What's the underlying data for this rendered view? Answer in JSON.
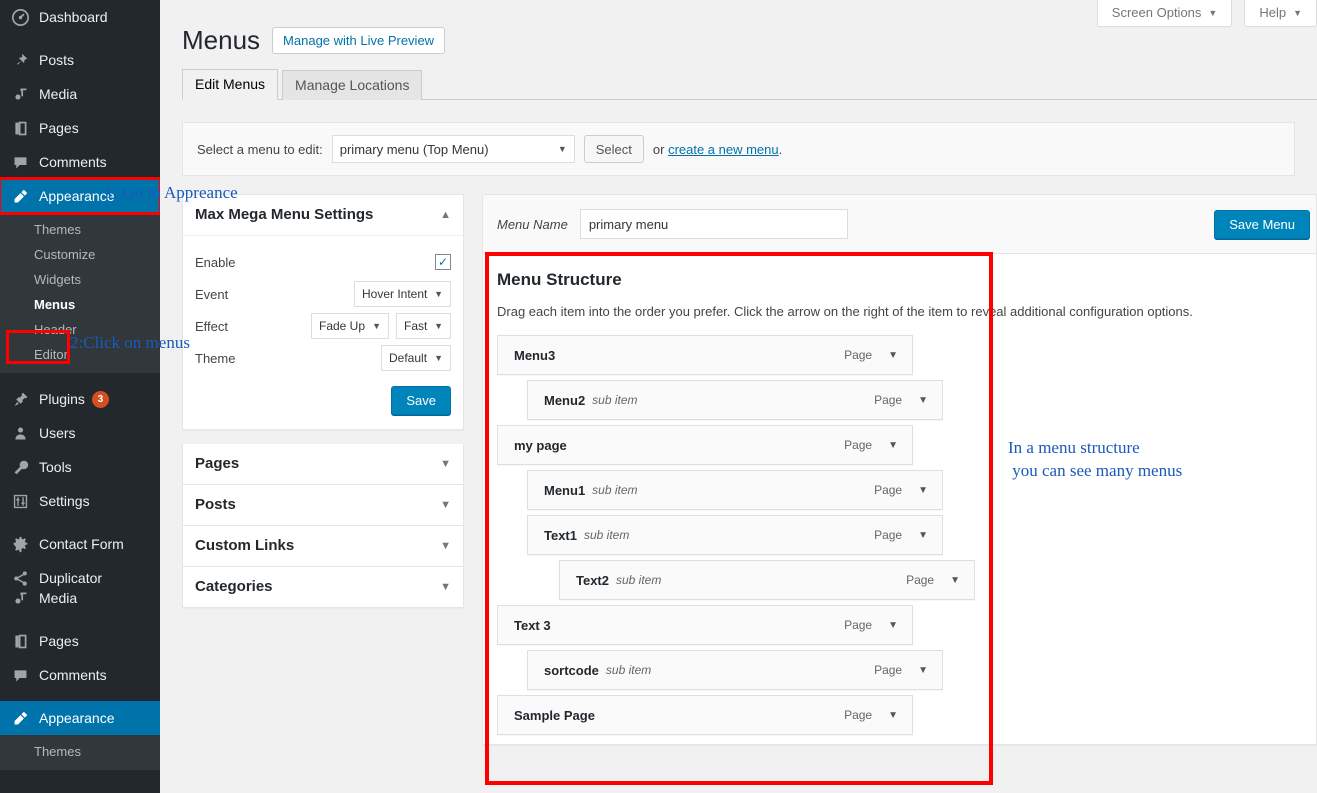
{
  "sidebar": {
    "top_items": [
      {
        "label": "Dashboard",
        "icon": "dashboard-icon"
      },
      {
        "label": "Posts",
        "icon": "posts-pin-icon"
      },
      {
        "label": "Media",
        "icon": "media-icon"
      },
      {
        "label": "Pages",
        "icon": "pages-icon"
      },
      {
        "label": "Comments",
        "icon": "comments-icon"
      },
      {
        "label": "Appearance",
        "icon": "appearance-brush-icon"
      }
    ],
    "appearance_submenu": [
      {
        "label": "Themes"
      },
      {
        "label": "Customize"
      },
      {
        "label": "Widgets"
      },
      {
        "label": "Menus"
      },
      {
        "label": "Header"
      },
      {
        "label": "Editor"
      }
    ],
    "bottom_items": [
      {
        "label": "Plugins",
        "icon": "plugins-icon",
        "badge": "3"
      },
      {
        "label": "Users",
        "icon": "users-icon"
      },
      {
        "label": "Tools",
        "icon": "tools-wrench-icon"
      },
      {
        "label": "Settings",
        "icon": "settings-sliders-icon"
      },
      {
        "label": "Contact Form",
        "icon": "gear-icon"
      },
      {
        "label": "Duplicator",
        "icon": "share-icon"
      },
      {
        "label": "Media",
        "icon": "media-icon"
      },
      {
        "label": "Pages",
        "icon": "pages-icon"
      },
      {
        "label": "Comments",
        "icon": "comments-icon"
      },
      {
        "label": "Appearance",
        "icon": "appearance-brush-icon"
      }
    ],
    "bottom_submenu": [
      {
        "label": "Themes"
      }
    ],
    "active_top": "Appearance",
    "active_sub": "Menus"
  },
  "screen_meta": {
    "screen_options": "Screen Options",
    "help": "Help",
    "caret": "▼"
  },
  "header": {
    "title": "Menus",
    "live_preview_button": "Manage with Live Preview"
  },
  "tabs": [
    {
      "label": "Edit Menus",
      "active": true
    },
    {
      "label": "Manage Locations",
      "active": false
    }
  ],
  "menu_select": {
    "label": "Select a menu to edit:",
    "selected": "primary menu (Top Menu)",
    "select_button": "Select",
    "or_prefix": "or ",
    "create_link": "create a new menu",
    "or_suffix": "."
  },
  "mega_menu": {
    "title": "Max Mega Menu Settings",
    "toggle": "▲",
    "rows": [
      {
        "label": "Enable",
        "type": "checkbox",
        "checked": true
      },
      {
        "label": "Event",
        "type": "select",
        "values": [
          "Hover Intent"
        ]
      },
      {
        "label": "Effect",
        "type": "select",
        "values": [
          "Fade Up",
          "Fast"
        ]
      },
      {
        "label": "Theme",
        "type": "select",
        "values": [
          "Default"
        ]
      }
    ],
    "save_label": "Save"
  },
  "accordion_panels": [
    {
      "title": "Pages",
      "toggle": "▼"
    },
    {
      "title": "Posts",
      "toggle": "▼"
    },
    {
      "title": "Custom Links",
      "toggle": "▼"
    },
    {
      "title": "Categories",
      "toggle": "▼"
    }
  ],
  "menu_edit": {
    "name_label": "Menu Name",
    "name_value": "primary menu",
    "name_placeholder": "Menu Name",
    "save_menu_label": "Save Menu",
    "structure_title": "Menu Structure",
    "structure_desc": "Drag each item into the order you prefer. Click the arrow on the right of the item to reveal additional configuration options.",
    "items": [
      {
        "title": "Menu3",
        "sub": "",
        "type": "Page",
        "depth": 0,
        "caret": "▼"
      },
      {
        "title": "Menu2",
        "sub": "sub item",
        "type": "Page",
        "depth": 1,
        "caret": "▼"
      },
      {
        "title": "my page",
        "sub": "",
        "type": "Page",
        "depth": 0,
        "caret": "▼"
      },
      {
        "title": "Menu1",
        "sub": "sub item",
        "type": "Page",
        "depth": 1,
        "caret": "▼"
      },
      {
        "title": "Text1",
        "sub": "sub item",
        "type": "Page",
        "depth": 1,
        "caret": "▼"
      },
      {
        "title": "Text2",
        "sub": "sub item",
        "type": "Page",
        "depth": 2,
        "caret": "▼"
      },
      {
        "title": "Text 3",
        "sub": "",
        "type": "Page",
        "depth": 0,
        "caret": "▼"
      },
      {
        "title": "sortcode",
        "sub": "sub item",
        "type": "Page",
        "depth": 1,
        "caret": "▼"
      },
      {
        "title": "Sample Page",
        "sub": "",
        "type": "Page",
        "depth": 0,
        "caret": "▼"
      }
    ]
  },
  "annotations": [
    {
      "name": "annotation-step-1",
      "text": "1: Go to Appreance"
    },
    {
      "name": "annotation-step-2",
      "text": "2:Click on menus"
    },
    {
      "name": "annotation-menu-structure",
      "text": "In a menu structure\n you can see many menus"
    }
  ],
  "colors": {
    "accent": "#0073aa",
    "primary_button": "#0085ba",
    "highlight_red": "#ff0000",
    "annotation_blue": "#1a5ab8",
    "sidebar_bg": "#23282d",
    "submenu_bg": "#32373c",
    "badge": "#d54e21"
  }
}
